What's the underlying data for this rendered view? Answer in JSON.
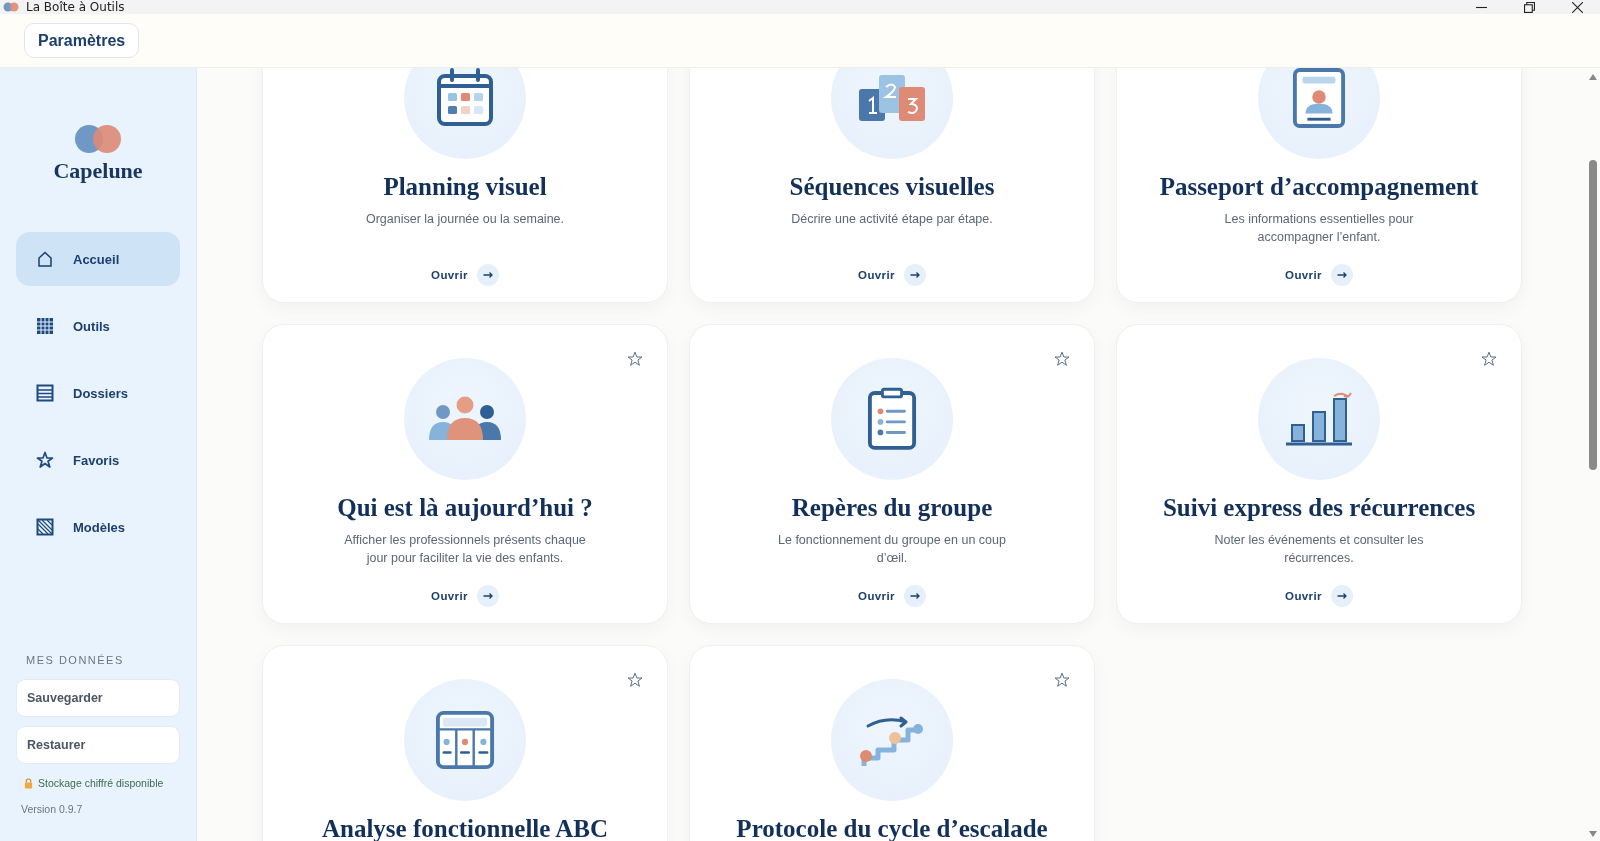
{
  "window": {
    "title": "La Boîte à Outils"
  },
  "header": {
    "settings_button": "Paramètres"
  },
  "sidebar": {
    "brand": "Capelune",
    "items": [
      {
        "label": "Accueil",
        "selected": true
      },
      {
        "label": "Outils",
        "selected": false
      },
      {
        "label": "Dossiers",
        "selected": false
      },
      {
        "label": "Favoris",
        "selected": false
      },
      {
        "label": "Modèles",
        "selected": false
      }
    ],
    "data_section": {
      "heading": "MES DONNÉES",
      "buttons": [
        "Sauvegarder",
        "Restaurer"
      ],
      "storage_note": "Stockage chiffré disponible",
      "version": "Version 0.9.7"
    }
  },
  "cards": [
    {
      "title": "Planning visuel",
      "description": "Organiser la journée ou la semaine.",
      "action": "Ouvrir"
    },
    {
      "title": "Séquences visuelles",
      "description": "Décrire une activité étape par étape.",
      "action": "Ouvrir"
    },
    {
      "title": "Passeport d’accompagnement",
      "description": "Les informations essentielles pour accompagner l’enfant.",
      "action": "Ouvrir"
    },
    {
      "title": "Qui est là aujourd’hui ?",
      "description": "Afficher les professionnels présents chaque jour pour faciliter la vie des enfants.",
      "action": "Ouvrir",
      "favorite": false
    },
    {
      "title": "Repères du groupe",
      "description": "Le fonctionnement du groupe en un coup d’œil.",
      "action": "Ouvrir",
      "favorite": false
    },
    {
      "title": "Suivi express des récurrences",
      "description": "Noter les événements et consulter les récurrences.",
      "action": "Ouvrir",
      "favorite": false
    },
    {
      "title": "Analyse fonctionnelle ABC",
      "favorite": false
    },
    {
      "title": "Protocole du cycle d’escalade",
      "favorite": false
    }
  ]
}
